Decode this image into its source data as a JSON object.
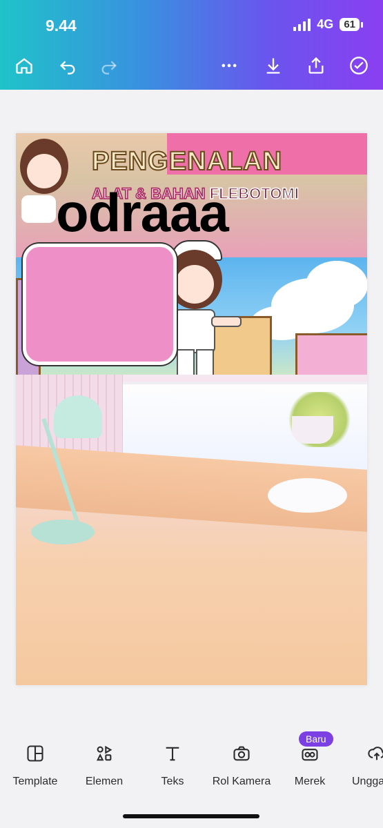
{
  "status": {
    "time": "9.44",
    "network": "4G",
    "battery": "61"
  },
  "toolbar": {
    "home": "home-icon",
    "undo": "undo-icon",
    "redo": "redo-icon",
    "more": "more-icon",
    "download": "download-icon",
    "share": "share-icon",
    "done": "check-icon"
  },
  "design": {
    "title": "PENGENALAN",
    "subtitle_part1": "ALAT & BAHAN",
    "subtitle_part2": "FLEBOTOMI",
    "overlay_text": "odraaa"
  },
  "bottom_nav": [
    {
      "label": "Template",
      "icon": "template-icon"
    },
    {
      "label": "Elemen",
      "icon": "elements-icon"
    },
    {
      "label": "Teks",
      "icon": "text-icon"
    },
    {
      "label": "Rol Kamera",
      "icon": "camera-icon"
    },
    {
      "label": "Merek",
      "icon": "brand-icon",
      "badge": "Baru"
    },
    {
      "label": "Ungga",
      "icon": "upload-icon"
    }
  ],
  "colors": {
    "accent": "#7b3fe4",
    "gradient_start": "#1fc3c9",
    "gradient_end": "#8a3ff1"
  }
}
